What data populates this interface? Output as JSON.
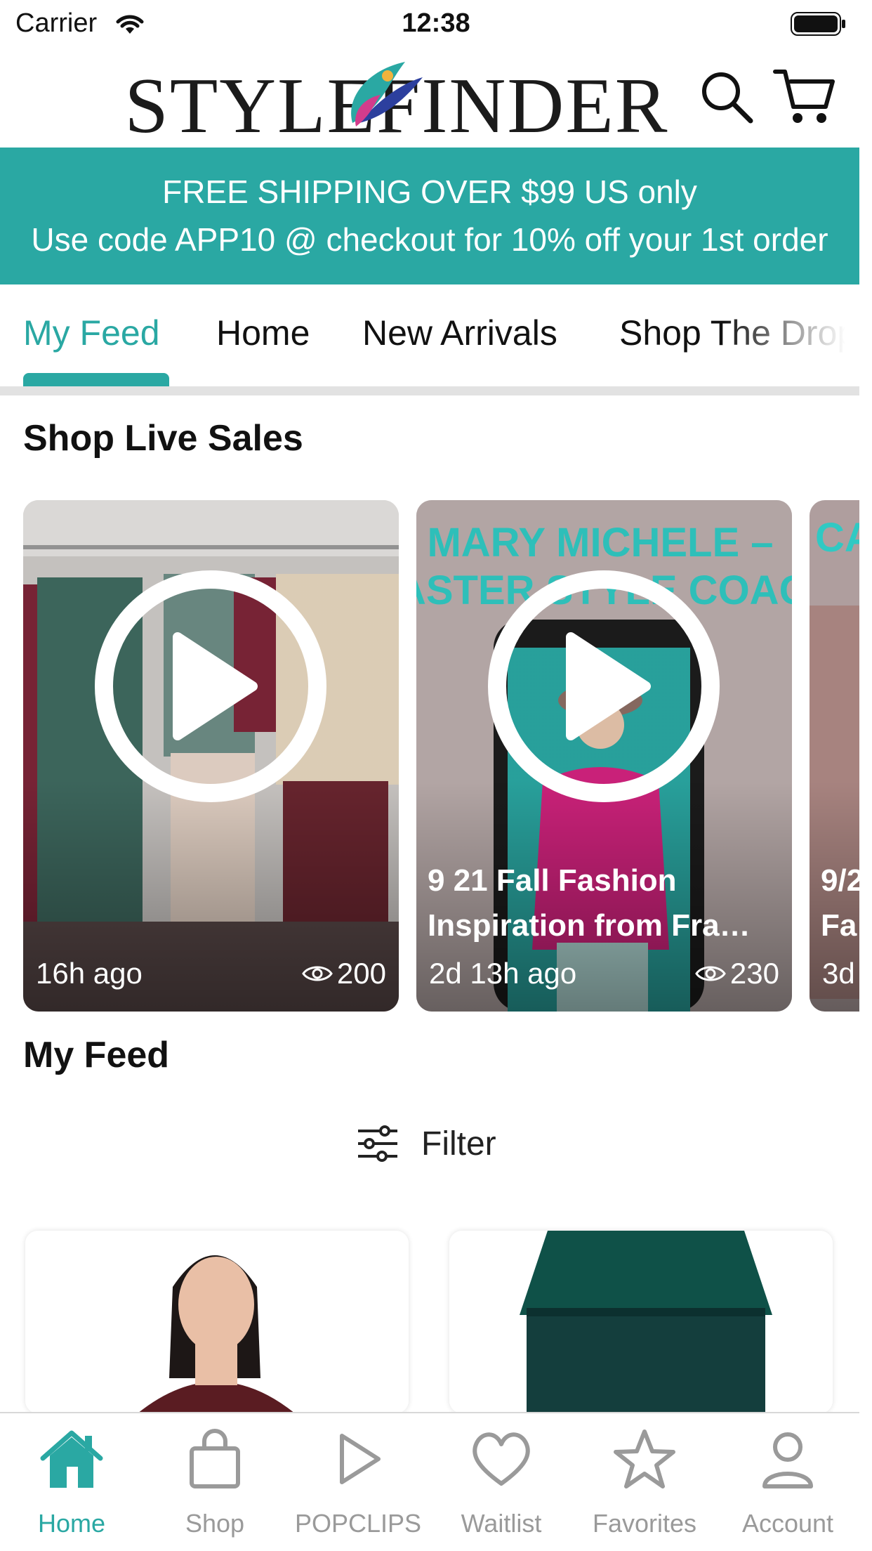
{
  "status_bar": {
    "carrier": "Carrier",
    "time": "12:38"
  },
  "header": {
    "logo_text": "STYLEFINDER"
  },
  "promo": {
    "line1": "FREE SHIPPING OVER $99 US only",
    "line2": "Use code APP10 @ checkout for 10% off your 1st order"
  },
  "tabs": [
    {
      "label": "My Feed",
      "active": true
    },
    {
      "label": "Home"
    },
    {
      "label": "New Arrivals"
    },
    {
      "label": "Shop The Drop"
    }
  ],
  "live_sales": {
    "title": "Shop Live Sales",
    "cards": [
      {
        "title": "",
        "time": "16h ago",
        "views": "200"
      },
      {
        "overlay_text": "MARY MICHELE – MASTER STYLE COACH",
        "title": "9 21 Fall Fashion Inspiration from Fra…",
        "time": "2d 13h ago",
        "views": "230"
      },
      {
        "overlay_text": "CA",
        "title": "9/2 Fa",
        "time": "3d"
      }
    ]
  },
  "feed": {
    "title": "My Feed",
    "filter_label": "Filter"
  },
  "bottom_nav": [
    {
      "label": "Home",
      "icon": "home-icon",
      "active": true
    },
    {
      "label": "Shop",
      "icon": "shopping-bag-icon"
    },
    {
      "label": "POPCLIPS",
      "icon": "play-outline-icon"
    },
    {
      "label": "Waitlist",
      "icon": "heart-icon"
    },
    {
      "label": "Favorites",
      "icon": "star-icon"
    },
    {
      "label": "Account",
      "icon": "user-icon"
    }
  ],
  "colors": {
    "accent": "#2aa8a3",
    "inactive": "#9a9a9a"
  }
}
